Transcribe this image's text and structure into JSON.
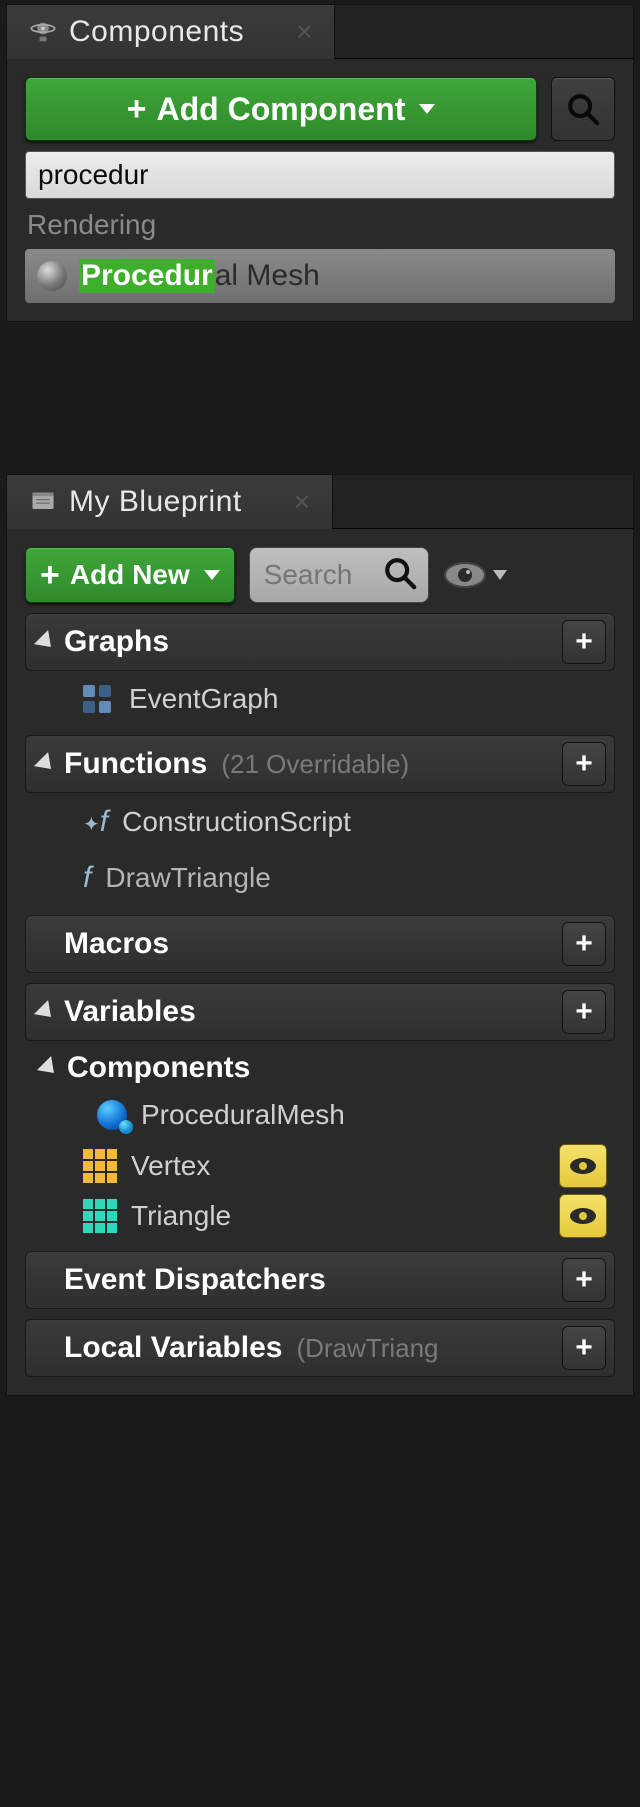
{
  "components_panel": {
    "title": "Components",
    "add_button": "Add Component",
    "search_value": "procedur",
    "category": "Rendering",
    "result": {
      "match": "Procedur",
      "rest": "al Mesh"
    }
  },
  "myblueprint_panel": {
    "title": "My Blueprint",
    "add_button": "Add New",
    "search_placeholder": "Search",
    "sections": {
      "graphs": {
        "title": "Graphs",
        "items": [
          "EventGraph"
        ]
      },
      "functions": {
        "title": "Functions",
        "sub": "(21 Overridable)",
        "items": [
          "ConstructionScript",
          "DrawTriangle"
        ]
      },
      "macros": {
        "title": "Macros"
      },
      "variables": {
        "title": "Variables"
      },
      "components_sub": {
        "title": "Components",
        "items": [
          "ProceduralMesh",
          "Vertex",
          "Triangle"
        ]
      },
      "dispatchers": {
        "title": "Event Dispatchers"
      },
      "local_vars": {
        "title": "Local Variables",
        "sub": "(DrawTriang"
      }
    }
  }
}
